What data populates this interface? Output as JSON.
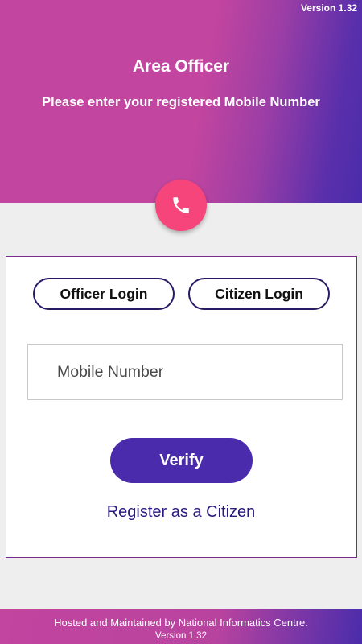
{
  "header": {
    "version": "Version 1.32",
    "title": "Area Officer",
    "subtitle": "Please enter your registered Mobile Number"
  },
  "badge": {
    "icon": "phone-icon",
    "color": "#f5457a"
  },
  "login_tabs": {
    "officer_label": "Officer Login",
    "citizen_label": "Citizen Login"
  },
  "form": {
    "mobile_placeholder": "Mobile Number",
    "mobile_value": "",
    "verify_label": "Verify",
    "register_link": "Register as a Citizen"
  },
  "footer": {
    "hosted_text": "Hosted and Maintained by National Informatics Centre.",
    "version": "Version 1.32"
  },
  "colors": {
    "header_gradient_start": "#c2459f",
    "header_gradient_end": "#4a2cab",
    "primary_button": "#4a2bac",
    "link": "#2a1a80",
    "card_border": "#7a2a8c"
  }
}
